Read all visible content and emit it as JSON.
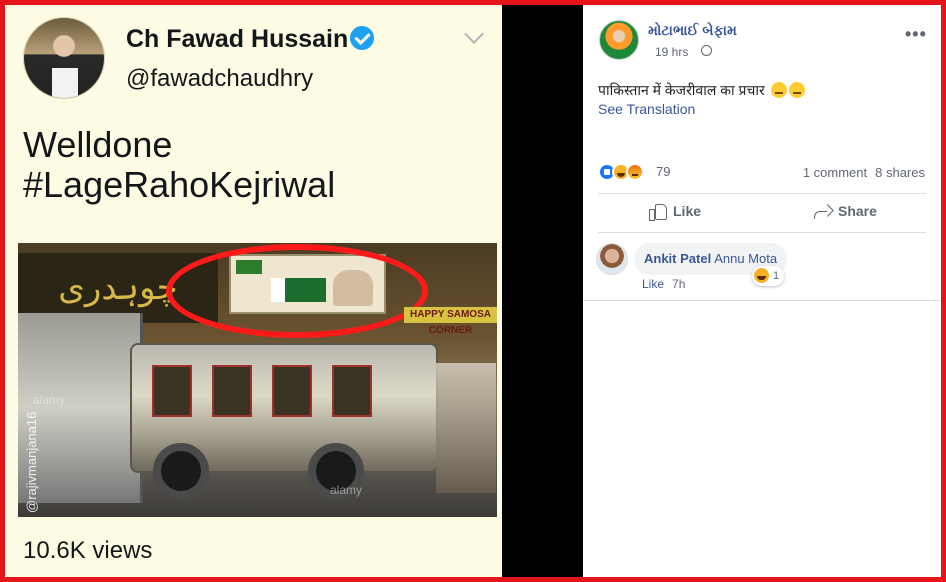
{
  "tweet": {
    "name": "Ch Fawad Hussain",
    "handle": "@fawadchaudhry",
    "text_lines": [
      "Welldone",
      "#LageRahoKejriwal"
    ],
    "views": "10.6K views",
    "image": {
      "watermark": "@rajivmanjana16",
      "stock_mark": "alamy",
      "shop_sign": "HAPPY SAMOSA CORNER"
    }
  },
  "facebook": {
    "page_name": "મોટાભાઈ બેફામ",
    "time": "19 hrs",
    "post_text": "पाकिस्तान में केजरीवाल का प्रचार",
    "see_translation": "See Translation",
    "reaction_count": "79",
    "comments": "1 comment",
    "shares": "8 shares",
    "actions": {
      "like": "Like",
      "share": "Share"
    },
    "comment": {
      "author": "Ankit Patel",
      "text": "Annu Mota",
      "like": "Like",
      "time": "7h",
      "reaction_count": "1"
    }
  },
  "colors": {
    "frame": "#e8141b",
    "tweet_bg": "#fdfbe3",
    "fb_link": "#385898",
    "verified": "#1da1f2"
  },
  "icons": [
    "verified-badge-icon",
    "chevron-down-icon",
    "globe-icon",
    "more-icon",
    "thumbs-up-icon",
    "share-arrow-icon",
    "like-reaction-icon",
    "haha-reaction-icon",
    "angry-reaction-icon",
    "thinking-emoji-icon"
  ]
}
